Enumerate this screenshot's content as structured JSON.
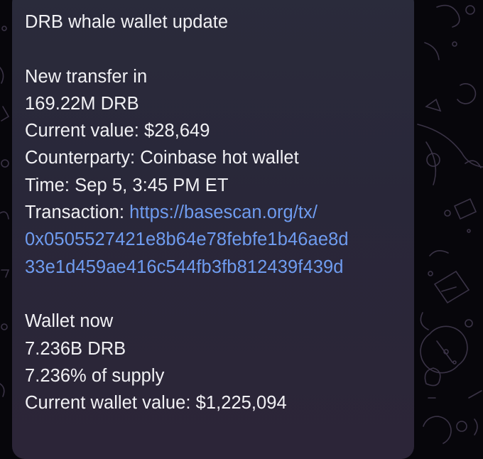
{
  "message": {
    "title": "DRB whale wallet update",
    "transfer_heading": "New transfer in",
    "transfer_amount": "169.22M DRB",
    "current_value": "Current value: $28,649",
    "counterparty": "Counterparty: Coinbase hot wallet",
    "time": "Time: Sep 5, 3:45 PM ET",
    "transaction_label": "Transaction: ",
    "transaction_link_line1": "https://basescan.org/tx/",
    "transaction_link_line2": "0x0505527421e8b64e78febfe1b46ae8d",
    "transaction_link_line3": "33e1d459ae416c544fb3fb812439f439d",
    "wallet_heading": "Wallet now",
    "wallet_amount": "7.236B DRB",
    "supply_share": "7.236% of supply",
    "wallet_value": "Current wallet value: $1,225,094"
  },
  "colors": {
    "background": "#07060b",
    "bubble": "#2a2b3b",
    "text": "#f1f1f4",
    "link": "#6f9cf0"
  }
}
